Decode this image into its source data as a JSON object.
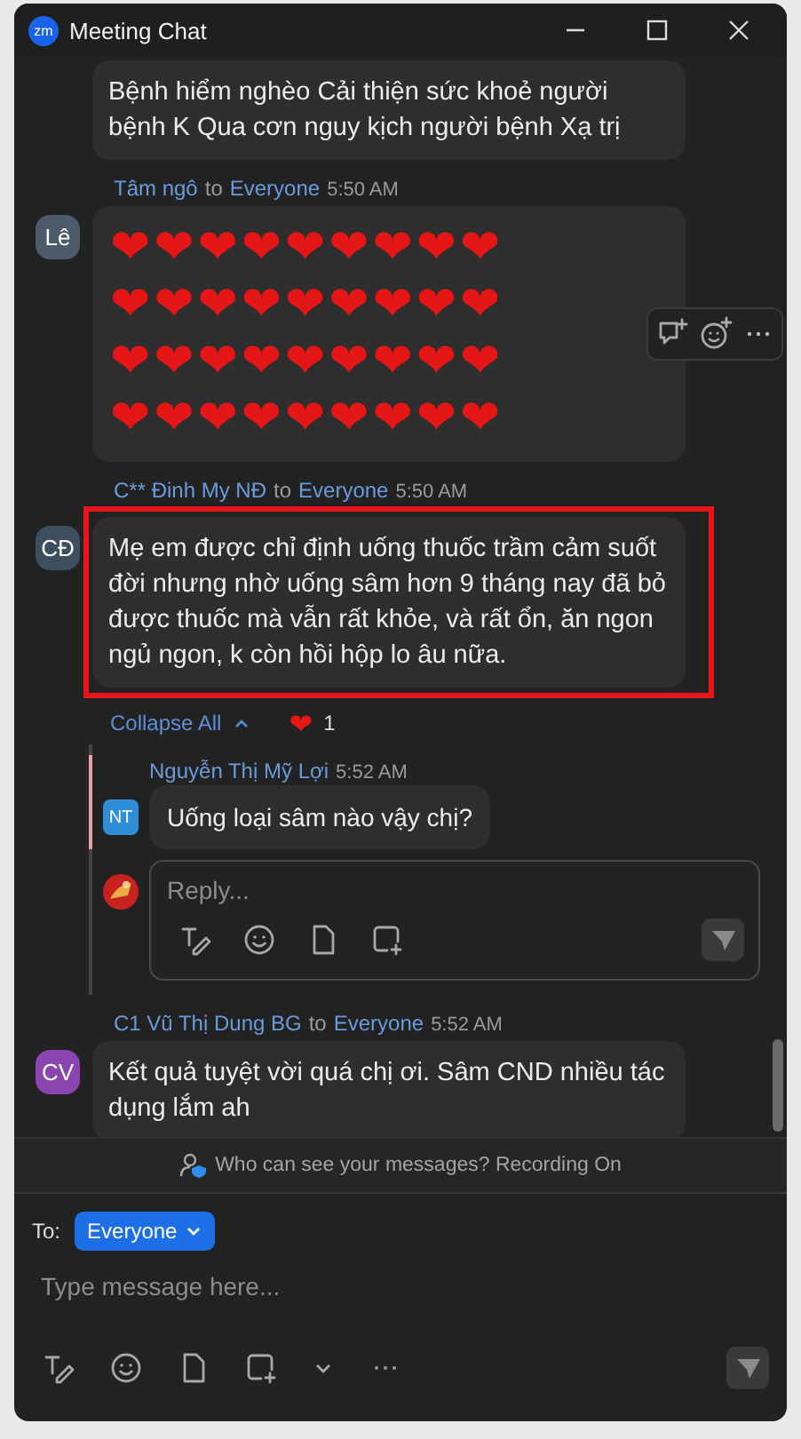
{
  "window": {
    "title": "Meeting Chat",
    "logo": "zm"
  },
  "messages": [
    {
      "kind": "text",
      "text": "Bệnh hiểm nghèo Cải thiện sức khoẻ người bệnh K Qua cơn nguy kịch người bệnh Xạ trị"
    },
    {
      "kind": "hearts",
      "sender": "Tâm ngô",
      "to_word": "to",
      "recipient": "Everyone",
      "time": "5:50 AM",
      "avatar": {
        "initials": "Lê",
        "color": "#4b5b6a"
      },
      "hovered": true,
      "hearts": [
        "❤❤❤❤❤❤❤❤❤",
        "❤❤❤❤❤❤❤❤❤",
        "❤❤❤❤❤❤❤❤❤",
        "❤❤❤❤❤❤❤❤❤"
      ]
    },
    {
      "kind": "text",
      "sender": "C** Đinh My NĐ",
      "to_word": "to",
      "recipient": "Everyone",
      "time": "5:50 AM",
      "avatar": {
        "initials": "CĐ",
        "color": "#3d4e5e"
      },
      "highlighted": true,
      "text": "Mẹ em được chỉ định uống thuốc trầm cảm suốt đời  nhưng nhờ uống sâm hơn 9 tháng nay đã bỏ được thuốc mà vẫn rất khỏe, và rất ổn, ăn ngon ngủ ngon, k còn hồi hộp lo âu nữa.",
      "collapse_label": "Collapse All",
      "reactions": [
        {
          "emoji": "❤",
          "count": "1"
        }
      ],
      "replies": [
        {
          "sender": "Nguyễn Thị Mỹ Lợi",
          "time": "5:52 AM",
          "avatar": {
            "initials": "NT",
            "color": "#2e8fd6"
          },
          "text": "Uống loại sâm nào vậy chị?"
        }
      ],
      "reply_box": {
        "placeholder": "Reply..."
      }
    },
    {
      "kind": "text",
      "sender": "C1 Vũ Thị Dung BG",
      "to_word": "to",
      "recipient": "Everyone",
      "time": "5:52 AM",
      "avatar": {
        "initials": "CV",
        "color": "#8b45b0"
      },
      "text": "Kết quả tuyệt vời quá chị ơi. Sâm CND nhiều tác dụng lắm ah"
    }
  ],
  "privacy_notice": "Who can see your messages? Recording On",
  "composer": {
    "to_label": "To:",
    "recipient": "Everyone",
    "placeholder": "Type message here..."
  }
}
